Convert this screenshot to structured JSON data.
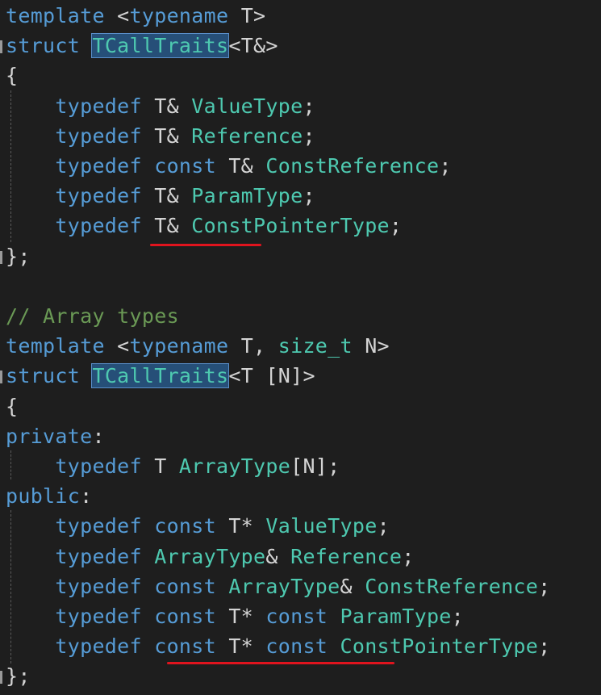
{
  "lines": [
    [
      {
        "t": "template ",
        "c": "kw"
      },
      {
        "t": "<",
        "c": "pl"
      },
      {
        "t": "typename",
        "c": "kw"
      },
      {
        "t": " T>",
        "c": "pl"
      }
    ],
    [
      {
        "t": "struct ",
        "c": "kw"
      },
      {
        "t": "TCallTraits",
        "c": "ty hl"
      },
      {
        "t": "<T&>",
        "c": "pl"
      }
    ],
    [
      {
        "t": "{",
        "c": "pl"
      }
    ],
    [
      {
        "t": "    ",
        "c": "pl"
      },
      {
        "t": "typedef ",
        "c": "kw"
      },
      {
        "t": "T& ",
        "c": "pl"
      },
      {
        "t": "ValueType",
        "c": "ty"
      },
      {
        "t": ";",
        "c": "pl"
      }
    ],
    [
      {
        "t": "    ",
        "c": "pl"
      },
      {
        "t": "typedef ",
        "c": "kw"
      },
      {
        "t": "T& ",
        "c": "pl"
      },
      {
        "t": "Reference",
        "c": "ty"
      },
      {
        "t": ";",
        "c": "pl"
      }
    ],
    [
      {
        "t": "    ",
        "c": "pl"
      },
      {
        "t": "typedef ",
        "c": "kw"
      },
      {
        "t": "const ",
        "c": "kw"
      },
      {
        "t": "T& ",
        "c": "pl"
      },
      {
        "t": "ConstReference",
        "c": "ty"
      },
      {
        "t": ";",
        "c": "pl"
      }
    ],
    [
      {
        "t": "    ",
        "c": "pl"
      },
      {
        "t": "typedef ",
        "c": "kw"
      },
      {
        "t": "T& ",
        "c": "pl"
      },
      {
        "t": "ParamType",
        "c": "ty"
      },
      {
        "t": ";",
        "c": "pl"
      }
    ],
    [
      {
        "t": "    ",
        "c": "pl"
      },
      {
        "t": "typedef ",
        "c": "kw"
      },
      {
        "t": "T& ",
        "c": "pl"
      },
      {
        "t": "ConstPointerType",
        "c": "ty"
      },
      {
        "t": ";",
        "c": "pl"
      }
    ],
    [
      {
        "t": "};",
        "c": "pl"
      }
    ],
    [],
    [
      {
        "t": "// Array types",
        "c": "cm"
      }
    ],
    [
      {
        "t": "template ",
        "c": "kw"
      },
      {
        "t": "<",
        "c": "pl"
      },
      {
        "t": "typename",
        "c": "kw"
      },
      {
        "t": " T, ",
        "c": "pl"
      },
      {
        "t": "size_t",
        "c": "ty"
      },
      {
        "t": " N>",
        "c": "pl"
      }
    ],
    [
      {
        "t": "struct ",
        "c": "kw"
      },
      {
        "t": "TCallTraits",
        "c": "ty hl"
      },
      {
        "t": "<T [N]>",
        "c": "pl"
      }
    ],
    [
      {
        "t": "{",
        "c": "pl"
      }
    ],
    [
      {
        "t": "private",
        "c": "kw"
      },
      {
        "t": ":",
        "c": "pl"
      }
    ],
    [
      {
        "t": "    ",
        "c": "pl"
      },
      {
        "t": "typedef ",
        "c": "kw"
      },
      {
        "t": "T ",
        "c": "pl"
      },
      {
        "t": "ArrayType",
        "c": "ty"
      },
      {
        "t": "[N];",
        "c": "pl"
      }
    ],
    [
      {
        "t": "public",
        "c": "kw"
      },
      {
        "t": ":",
        "c": "pl"
      }
    ],
    [
      {
        "t": "    ",
        "c": "pl"
      },
      {
        "t": "typedef ",
        "c": "kw"
      },
      {
        "t": "const ",
        "c": "kw"
      },
      {
        "t": "T* ",
        "c": "pl"
      },
      {
        "t": "ValueType",
        "c": "ty"
      },
      {
        "t": ";",
        "c": "pl"
      }
    ],
    [
      {
        "t": "    ",
        "c": "pl"
      },
      {
        "t": "typedef ",
        "c": "kw"
      },
      {
        "t": "ArrayType",
        "c": "ty"
      },
      {
        "t": "& ",
        "c": "pl"
      },
      {
        "t": "Reference",
        "c": "ty"
      },
      {
        "t": ";",
        "c": "pl"
      }
    ],
    [
      {
        "t": "    ",
        "c": "pl"
      },
      {
        "t": "typedef ",
        "c": "kw"
      },
      {
        "t": "const ",
        "c": "kw"
      },
      {
        "t": "ArrayType",
        "c": "ty"
      },
      {
        "t": "& ",
        "c": "pl"
      },
      {
        "t": "ConstReference",
        "c": "ty"
      },
      {
        "t": ";",
        "c": "pl"
      }
    ],
    [
      {
        "t": "    ",
        "c": "pl"
      },
      {
        "t": "typedef ",
        "c": "kw"
      },
      {
        "t": "const ",
        "c": "kw"
      },
      {
        "t": "T* ",
        "c": "pl"
      },
      {
        "t": "const ",
        "c": "kw"
      },
      {
        "t": "ParamType",
        "c": "ty"
      },
      {
        "t": ";",
        "c": "pl"
      }
    ],
    [
      {
        "t": "    ",
        "c": "pl"
      },
      {
        "t": "typedef ",
        "c": "kw"
      },
      {
        "t": "const ",
        "c": "kw"
      },
      {
        "t": "T* ",
        "c": "pl"
      },
      {
        "t": "const ",
        "c": "kw"
      },
      {
        "t": "ConstPointerType",
        "c": "ty"
      },
      {
        "t": ";",
        "c": "pl"
      }
    ],
    [
      {
        "t": "};",
        "c": "pl"
      }
    ]
  ],
  "colors": {
    "background": "#1e1e1e",
    "keyword": "#569cd6",
    "type": "#4ec9b0",
    "plain": "#d4d4d4",
    "comment": "#6a9955",
    "highlight": "#264f78",
    "squiggle": "#e0141e"
  }
}
